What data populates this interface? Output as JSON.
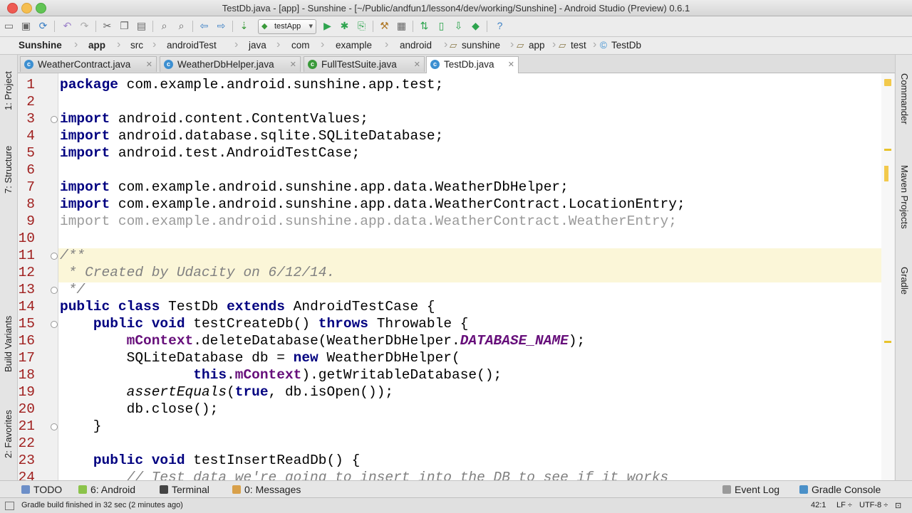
{
  "window": {
    "title": "TestDb.java - [app] - Sunshine - [~/Public/andfun1/lesson4/dev/working/Sunshine] - Android Studio (Preview) 0.6.1"
  },
  "toolbar": {
    "run_config": "testApp"
  },
  "breadcrumbs": [
    "Sunshine",
    "app",
    "src",
    "androidTest",
    "java",
    "com",
    "example",
    "android",
    "sunshine",
    "app",
    "test",
    "TestDb"
  ],
  "tabs": [
    {
      "label": "WeatherContract.java",
      "active": false
    },
    {
      "label": "WeatherDbHelper.java",
      "active": false
    },
    {
      "label": "FullTestSuite.java",
      "active": false
    },
    {
      "label": "TestDb.java",
      "active": true
    }
  ],
  "left_tool_windows": [
    "1: Project",
    "7: Structure",
    "Build Variants",
    "2: Favorites"
  ],
  "right_tool_windows": [
    "Commander",
    "Maven Projects",
    "Gradle"
  ],
  "code_lines": [
    [
      {
        "t": "package",
        "c": "kw"
      },
      {
        "t": " com.example.android.sunshine.app.test;"
      }
    ],
    [],
    [
      {
        "t": "import",
        "c": "kw"
      },
      {
        "t": " android.content.ContentValues;"
      }
    ],
    [
      {
        "t": "import",
        "c": "kw"
      },
      {
        "t": " android.database.sqlite.SQLiteDatabase;"
      }
    ],
    [
      {
        "t": "import",
        "c": "kw"
      },
      {
        "t": " android.test.AndroidTestCase;"
      }
    ],
    [],
    [
      {
        "t": "import",
        "c": "kw"
      },
      {
        "t": " com.example.android.sunshine.app.data.WeatherDbHelper;"
      }
    ],
    [
      {
        "t": "import",
        "c": "kw"
      },
      {
        "t": " com.example.android.sunshine.app.data.WeatherContract.LocationEntry;"
      }
    ],
    [
      {
        "t": "import com.example.android.sunshine.app.data.WeatherContract.WeatherEntry;",
        "c": "unused"
      }
    ],
    [],
    [
      {
        "t": "/**",
        "c": "comment"
      }
    ],
    [
      {
        "t": " * Created by Udacity on 6/12/14.",
        "c": "comment"
      }
    ],
    [
      {
        "t": " */",
        "c": "comment"
      }
    ],
    [
      {
        "t": "public",
        "c": "kw"
      },
      {
        "t": " "
      },
      {
        "t": "class",
        "c": "kw"
      },
      {
        "t": " TestDb "
      },
      {
        "t": "extends",
        "c": "kw"
      },
      {
        "t": " AndroidTestCase {"
      }
    ],
    [
      {
        "t": "    "
      },
      {
        "t": "public",
        "c": "kw"
      },
      {
        "t": " "
      },
      {
        "t": "void",
        "c": "kw"
      },
      {
        "t": " testCreateDb() "
      },
      {
        "t": "throws",
        "c": "kw"
      },
      {
        "t": " Throwable {"
      }
    ],
    [
      {
        "t": "        "
      },
      {
        "t": "mContext",
        "c": "field"
      },
      {
        "t": ".deleteDatabase(WeatherDbHelper."
      },
      {
        "t": "DATABASE_NAME",
        "c": "const"
      },
      {
        "t": ");"
      }
    ],
    [
      {
        "t": "        SQLiteDatabase db = "
      },
      {
        "t": "new",
        "c": "kw"
      },
      {
        "t": " WeatherDbHelper("
      }
    ],
    [
      {
        "t": "                "
      },
      {
        "t": "this",
        "c": "kw"
      },
      {
        "t": "."
      },
      {
        "t": "mContext",
        "c": "field"
      },
      {
        "t": ").getWritableDatabase();"
      }
    ],
    [
      {
        "t": "        "
      },
      {
        "t": "assertEquals",
        "c": "italic"
      },
      {
        "t": "("
      },
      {
        "t": "true",
        "c": "kw"
      },
      {
        "t": ", db.isOpen());"
      }
    ],
    [
      {
        "t": "        db.close();"
      }
    ],
    [
      {
        "t": "    }"
      }
    ],
    [],
    [
      {
        "t": "    "
      },
      {
        "t": "public",
        "c": "kw"
      },
      {
        "t": " "
      },
      {
        "t": "void",
        "c": "kw"
      },
      {
        "t": " testInsertReadDb() {"
      }
    ],
    [
      {
        "t": "        // Test data we're going to insert into the DB to see if it works",
        "c": "comment"
      }
    ]
  ],
  "line_numbers": [
    "1",
    "2",
    "3",
    "4",
    "5",
    "6",
    "7",
    "8",
    "9",
    "10",
    "11",
    "12",
    "13",
    "14",
    "15",
    "16",
    "17",
    "18",
    "19",
    "20",
    "21",
    "22",
    "23",
    "24"
  ],
  "bottom_tools": {
    "todo": "TODO",
    "android": "6: Android",
    "terminal": "Terminal",
    "messages": "0: Messages",
    "event_log": "Event Log",
    "gradle_console": "Gradle Console"
  },
  "status": {
    "message": "Gradle build finished in 32 sec (2 minutes ago)",
    "position": "42:1",
    "line_sep": "LF ÷",
    "encoding": "UTF-8 ÷"
  }
}
